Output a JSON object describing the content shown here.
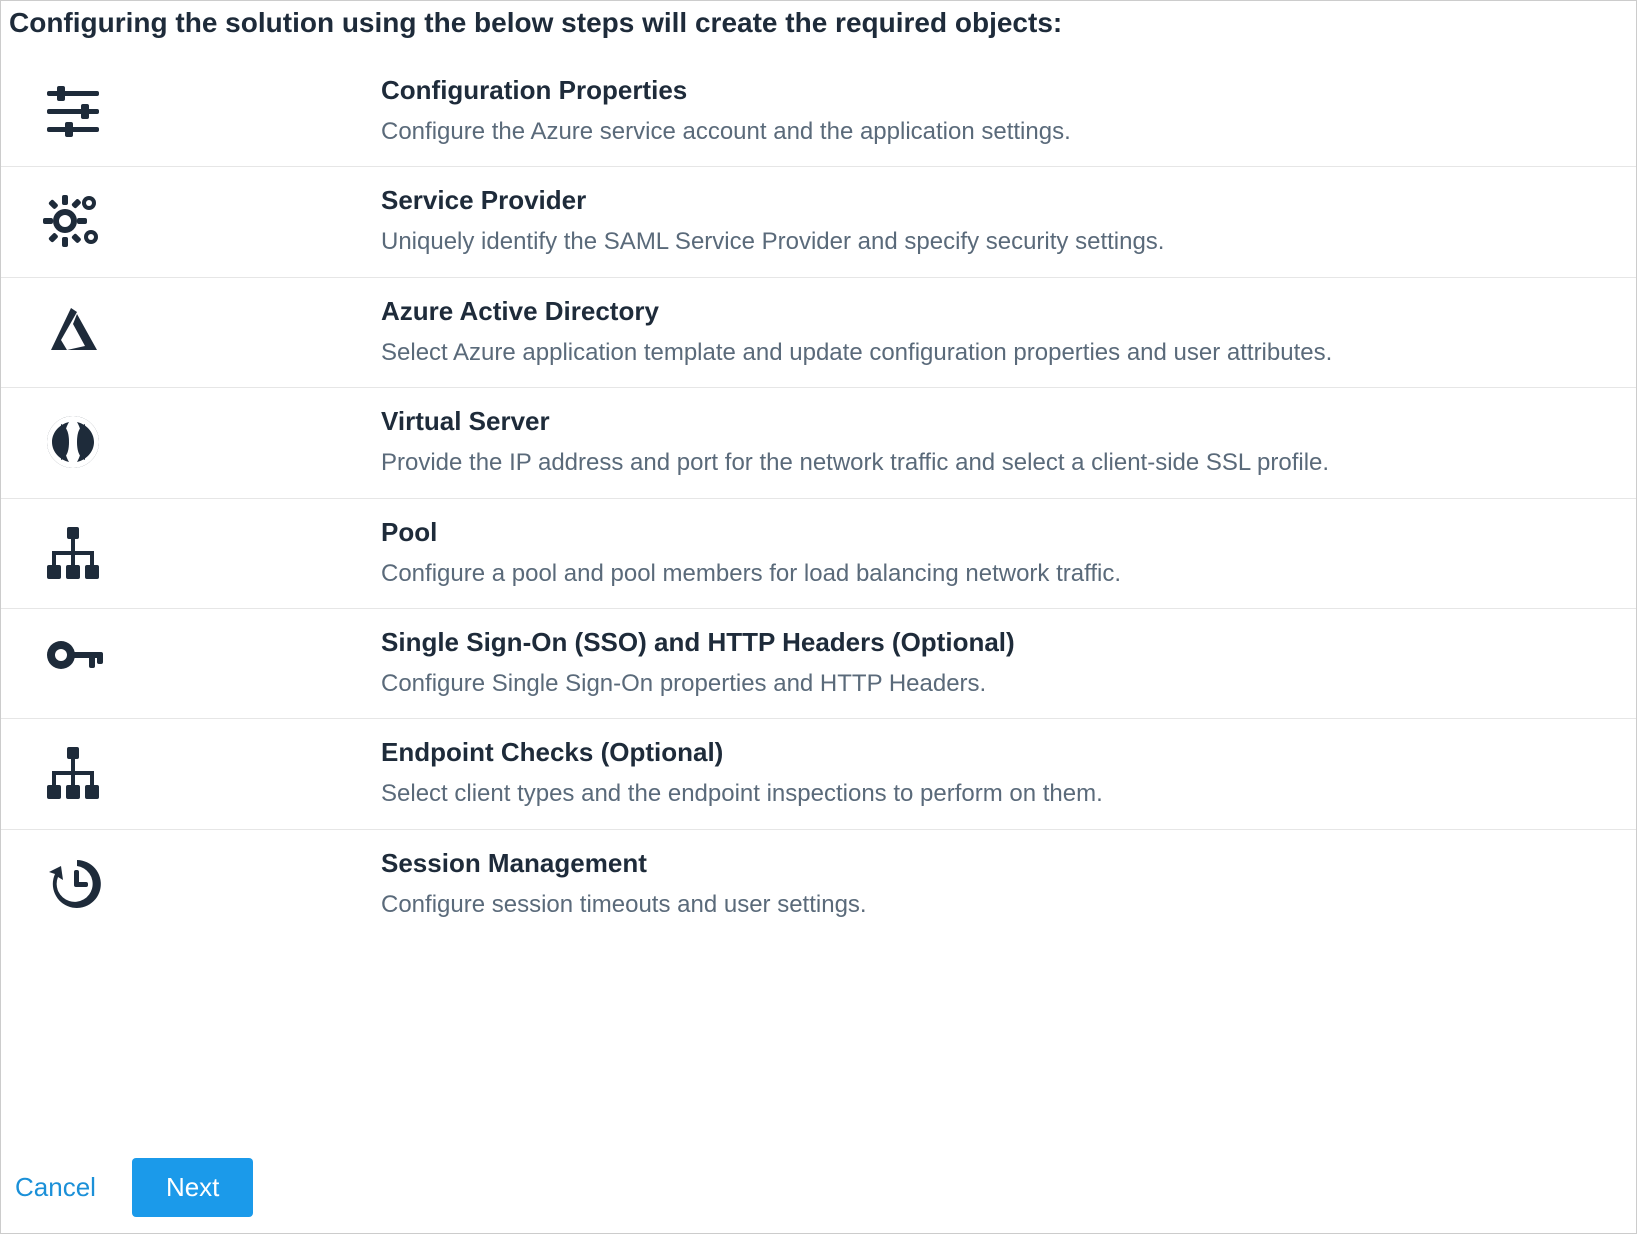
{
  "heading": "Configuring the solution using the below steps will create the required objects:",
  "steps": [
    {
      "icon": "sliders-icon",
      "title": "Configuration Properties",
      "desc": "Configure the Azure service account and the application settings."
    },
    {
      "icon": "gears-icon",
      "title": "Service Provider",
      "desc": "Uniquely identify the SAML Service Provider and specify security settings."
    },
    {
      "icon": "azure-icon",
      "title": "Azure Active Directory",
      "desc": "Select Azure application template and update configuration properties and user attributes."
    },
    {
      "icon": "globe-icon",
      "title": "Virtual Server",
      "desc": "Provide the IP address and port for the network traffic and select a client-side SSL profile."
    },
    {
      "icon": "sitemap-icon",
      "title": "Pool",
      "desc": "Configure a pool and pool members for load balancing network traffic."
    },
    {
      "icon": "key-icon",
      "title": "Single Sign-On (SSO) and HTTP Headers (Optional)",
      "desc": "Configure Single Sign-On properties and HTTP Headers."
    },
    {
      "icon": "sitemap-icon",
      "title": "Endpoint Checks (Optional)",
      "desc": "Select client types and the endpoint inspections to perform on them."
    },
    {
      "icon": "history-icon",
      "title": "Session Management",
      "desc": "Configure session timeouts and user settings."
    }
  ],
  "footer": {
    "cancel": "Cancel",
    "next": "Next"
  }
}
